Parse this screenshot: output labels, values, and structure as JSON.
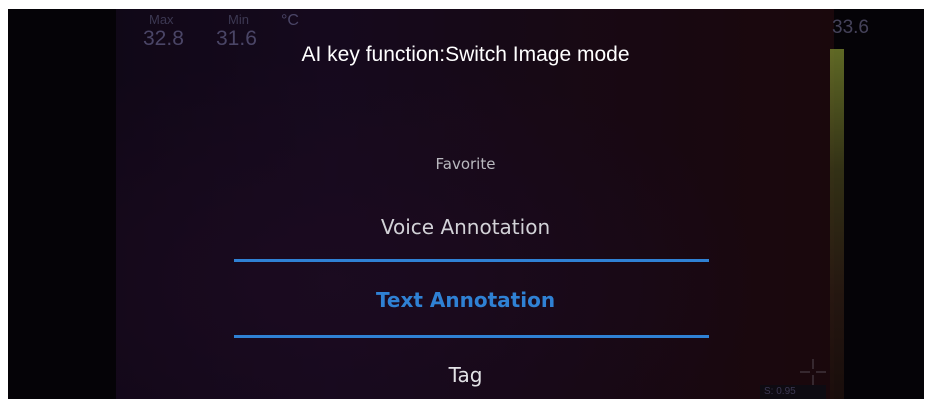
{
  "hud": {
    "max_label": "Max",
    "min_label": "Min",
    "max_value": "32.8",
    "min_value": "31.6",
    "unit": "°C",
    "scale_max": "33.6",
    "corner_tag": "S: 0.95"
  },
  "dialog": {
    "title": "AI key function:Switch Image mode"
  },
  "picker": {
    "items": [
      {
        "label": "Favorite"
      },
      {
        "label": "Voice Annotation"
      },
      {
        "label": "Text Annotation",
        "selected": true
      },
      {
        "label": "Tag"
      }
    ],
    "accent_color": "#2f81d4"
  },
  "icons": {
    "crosshair": "crosshair-icon"
  }
}
